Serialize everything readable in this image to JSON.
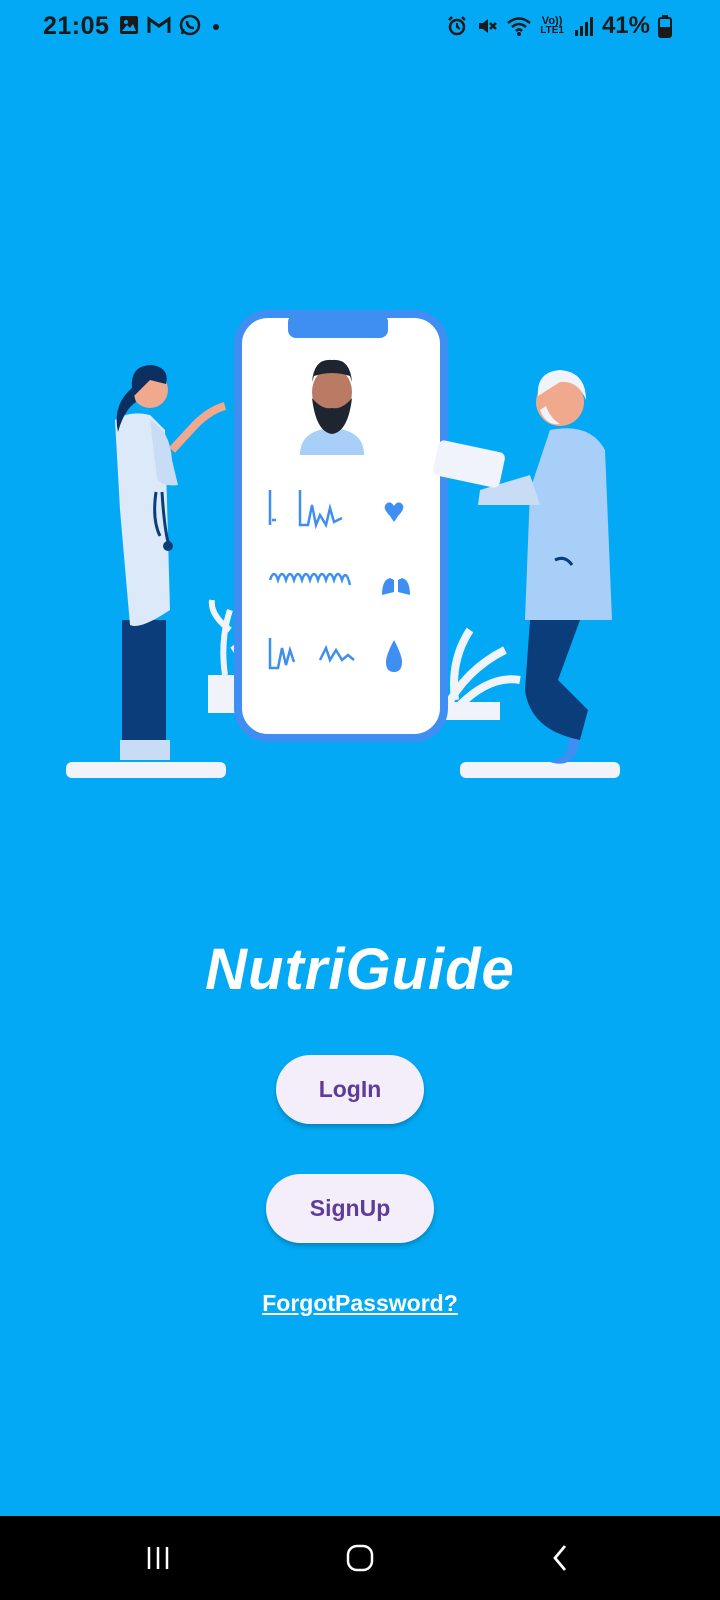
{
  "status_bar": {
    "time": "21:05",
    "battery": "41%",
    "network_label": "LTE1",
    "notification_icons": [
      "image-icon",
      "gmail-icon",
      "whatsapp-icon",
      "dot-icon"
    ],
    "system_icons": [
      "alarm-icon",
      "mute-icon",
      "wifi-icon",
      "volte-icon",
      "signal-icon",
      "battery-icon"
    ]
  },
  "app": {
    "title": "NutriGuide",
    "login_label": "LogIn",
    "signup_label": "SignUp",
    "forgot_label": "ForgotPassword?"
  },
  "colors": {
    "background": "#03A9F4",
    "button_bg": "#F3EEF9",
    "button_text": "#5E3C99",
    "nav_bar": "#000000"
  },
  "nav_bar": {
    "buttons": [
      "recent-apps-icon",
      "home-icon",
      "back-icon"
    ]
  }
}
